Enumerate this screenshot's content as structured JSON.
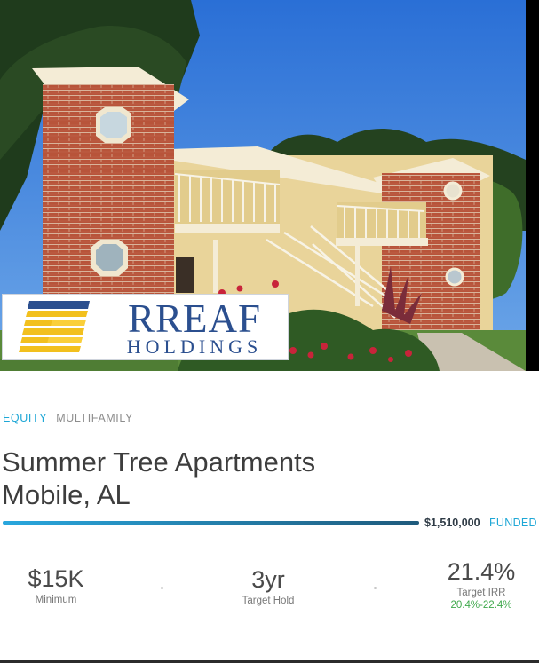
{
  "logo": {
    "line1": "RREAF",
    "line2": "HOLDINGS"
  },
  "tags": {
    "asset_class": "EQUITY",
    "property_type": "MULTIFAMILY"
  },
  "property": {
    "name": "Summer Tree Apartments",
    "location": "Mobile, AL"
  },
  "funding": {
    "amount": "$1,510,000",
    "status": "FUNDED",
    "progress_fraction": 1.0
  },
  "stats": {
    "minimum": {
      "value": "$15K",
      "label": "Minimum"
    },
    "hold": {
      "value": "3yr",
      "label": "Target Hold"
    },
    "irr": {
      "value": "21.4%",
      "label": "Target IRR",
      "range": "20.4%-22.4%"
    }
  },
  "colors": {
    "accent_blue": "#1ea7d6",
    "progress_start": "#29a7de",
    "progress_end": "#1f5a7c",
    "range_green": "#3ea84b",
    "logo_navy": "#2b4f8f",
    "logo_gold": "#f2c01e"
  }
}
